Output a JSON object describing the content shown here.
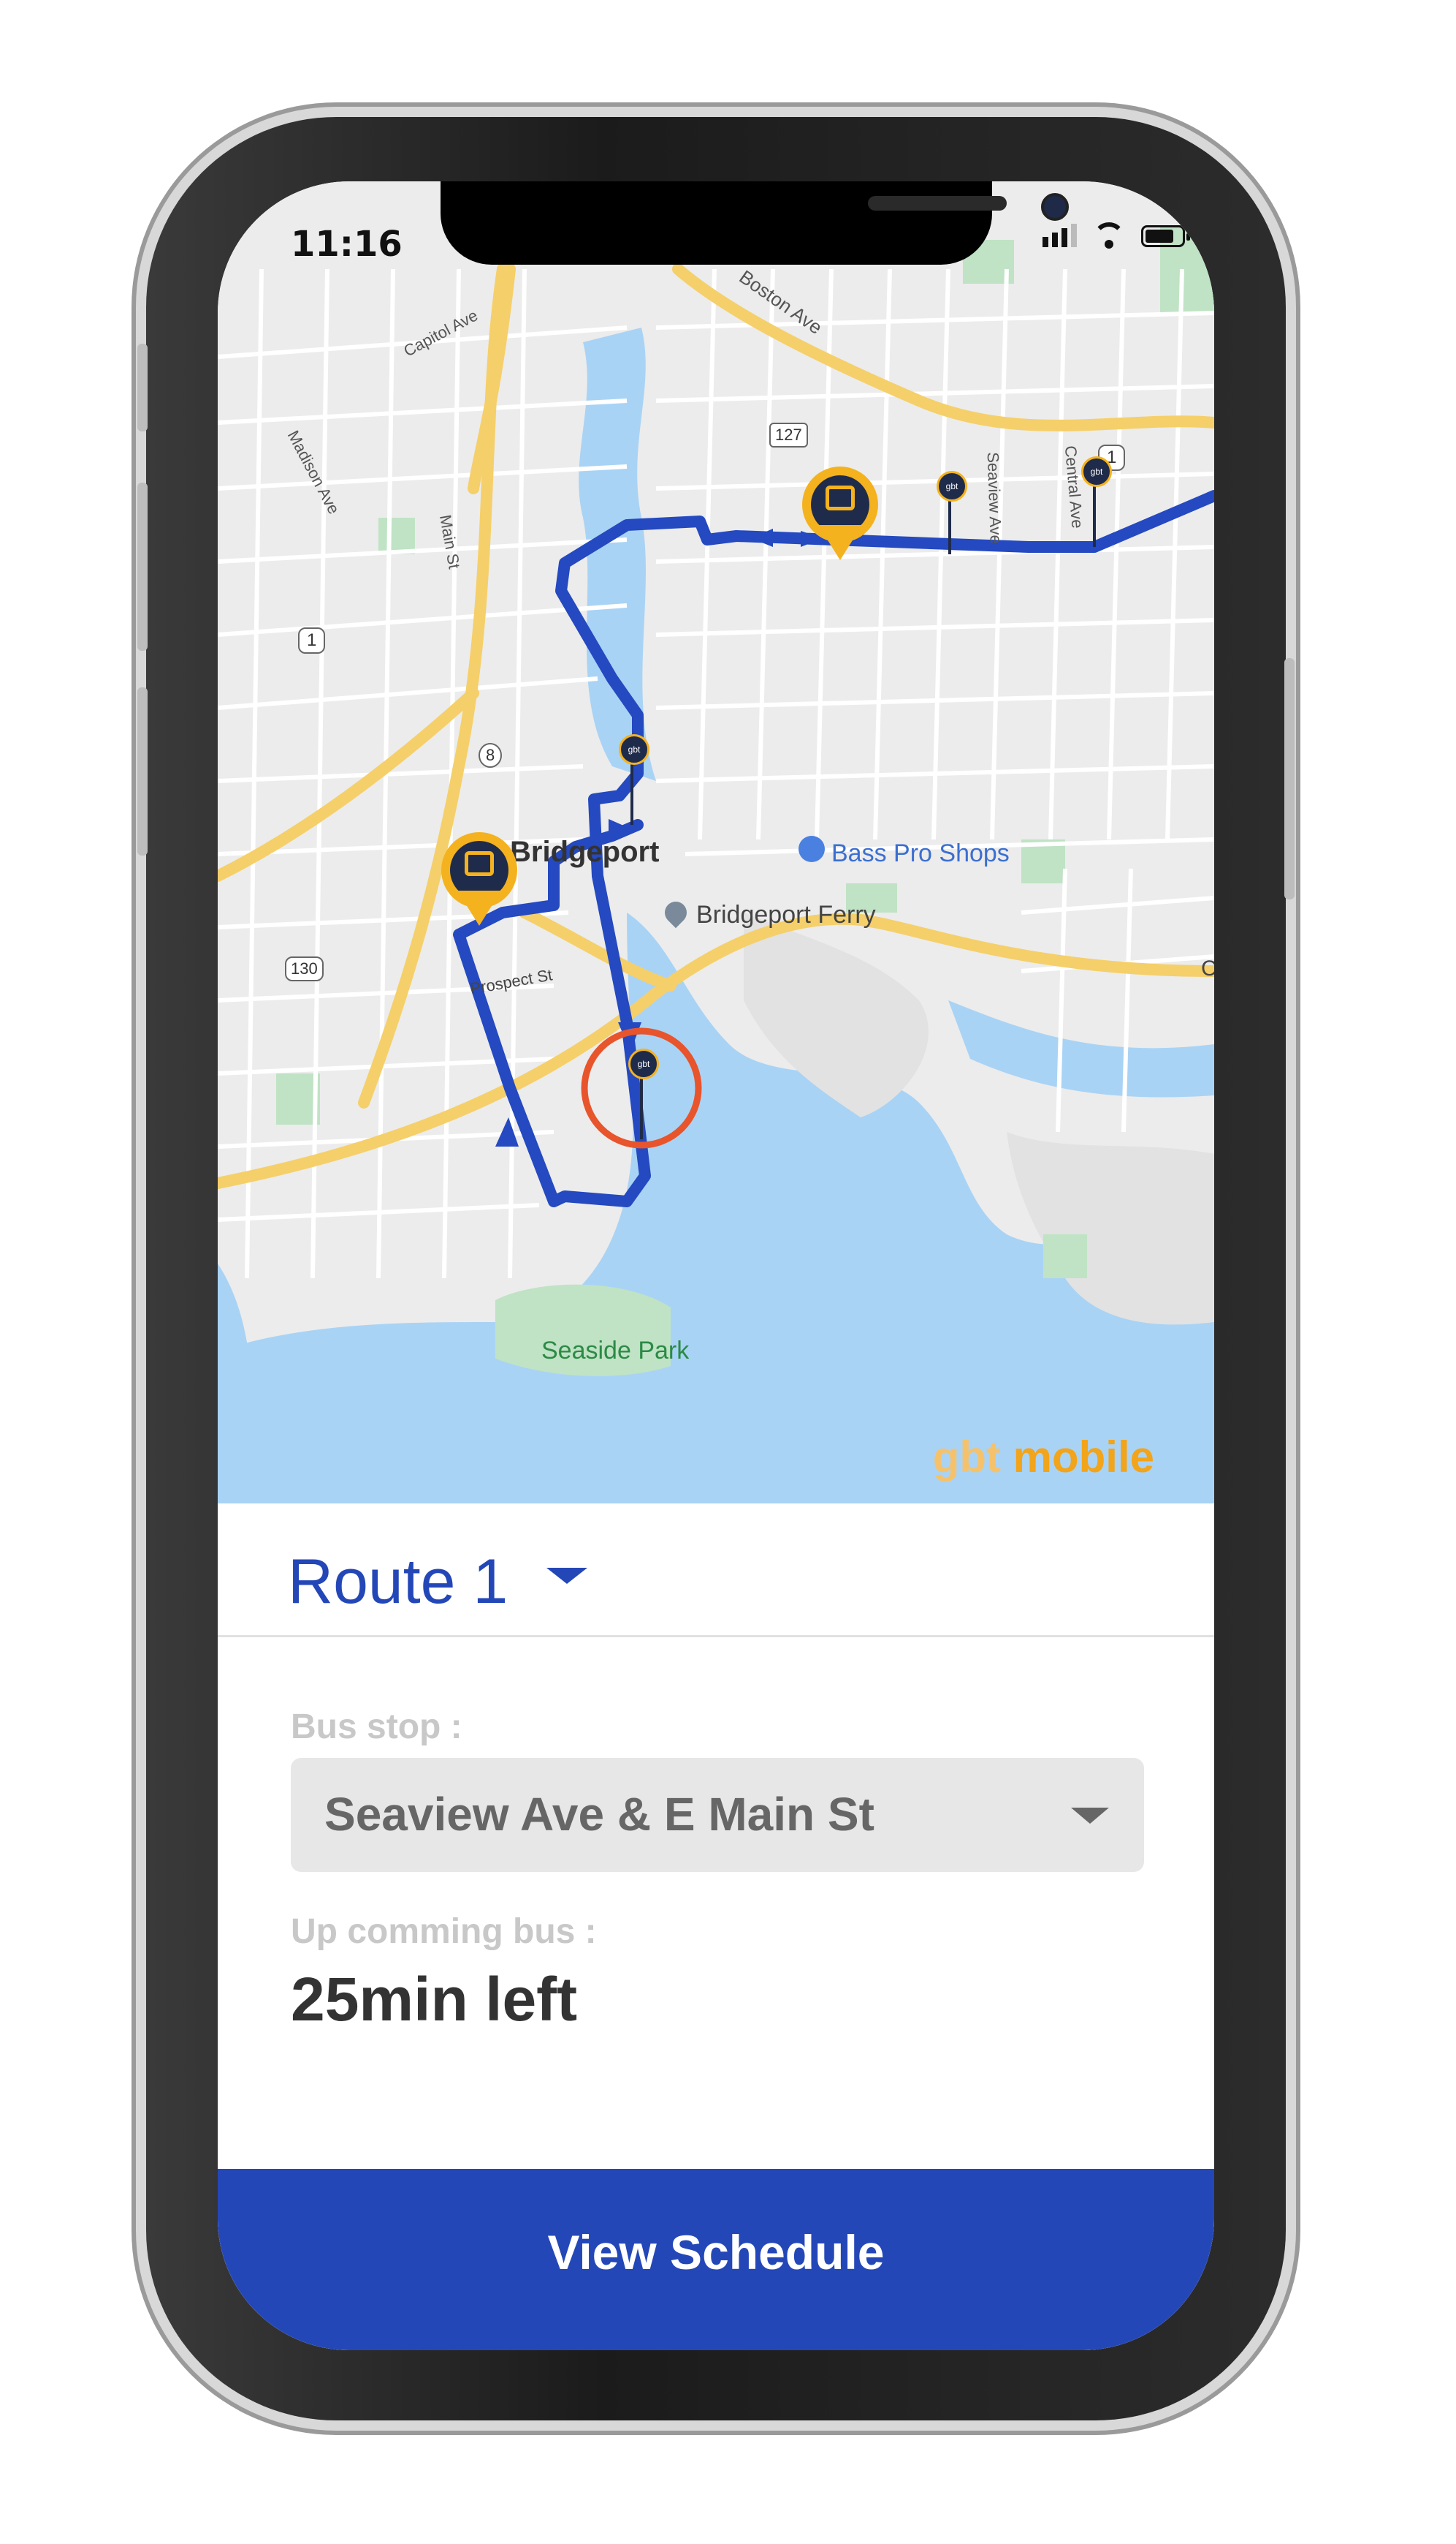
{
  "status": {
    "time": "11:16"
  },
  "map": {
    "labels": {
      "capitol": "Capitol Ave",
      "boston": "Boston Ave",
      "madison": "Madison Ave",
      "main": "Main St",
      "seaview": "Seaview Ave",
      "central": "Central Ave",
      "prospect": "Prospect St",
      "bridgeport": "Bridgeport",
      "bass_pro": "Bass Pro Shops",
      "ferry": "Bridgeport Ferry",
      "seaside": "Seaside Park",
      "c_edge": "C"
    },
    "route_shields": {
      "r127": "127",
      "r1a": "1",
      "r1b": "1",
      "r8": "8",
      "r130": "130"
    },
    "stop_marker_text": "gbt",
    "brand": {
      "part1": "gbt",
      "part2": " mobile"
    }
  },
  "panel": {
    "route_title": "Route 1",
    "bus_stop_label": "Bus stop :",
    "bus_stop_value": "Seaview Ave & E Main St",
    "upcoming_label": "Up comming bus :",
    "eta": "25min left",
    "cta": "View Schedule"
  },
  "colors": {
    "accent_blue": "#2447b8",
    "route_line": "#2449c0",
    "bus_pin": "#f4b21f",
    "highlight_ring": "#e8542b",
    "water": "#a9d3f5",
    "park": "#bfe3c4",
    "highway": "#f5cf6a"
  },
  "icons": [
    "signal-icon",
    "wifi-icon",
    "battery-icon",
    "bus-pin-icon",
    "stop-marker-icon",
    "dropdown-caret-icon",
    "shopping-bag-icon",
    "location-pin-icon"
  ]
}
